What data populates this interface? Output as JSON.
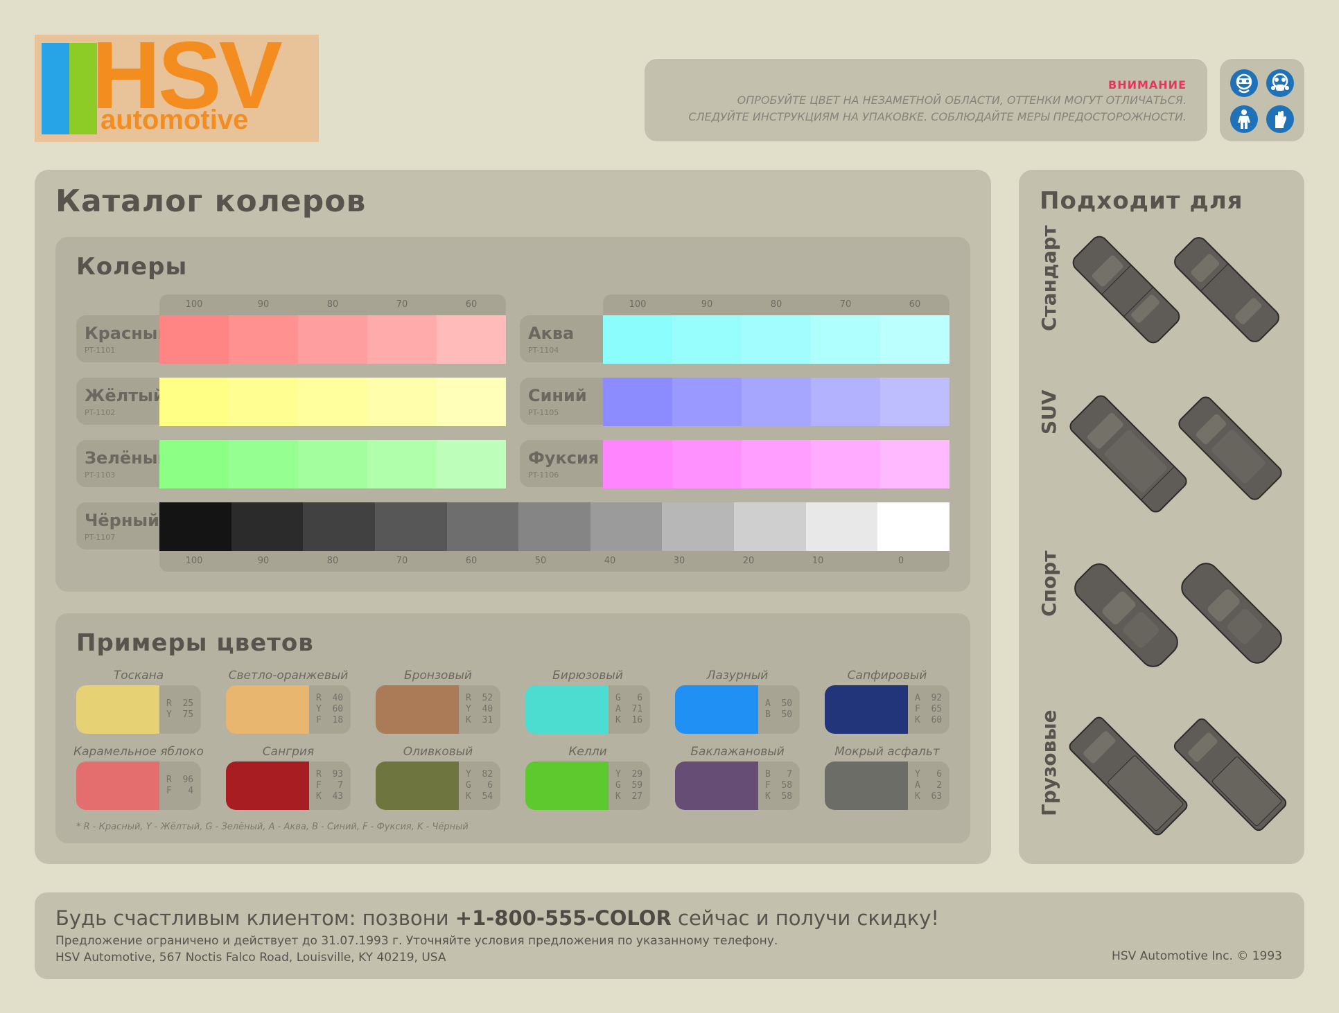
{
  "logo": {
    "hsv": "HSV",
    "automotive": "automotive"
  },
  "warning": {
    "title": "ВНИМАНИЕ",
    "line1": "ОПРОБУЙТЕ ЦВЕТ НА НЕЗАМЕТНОЙ ОБЛАСТИ, ОТТЕНКИ МОГУТ ОТЛИЧАТЬСЯ.",
    "line2": "СЛЕДУЙТЕ ИНСТРУКЦИЯМ НА УПАКОВКЕ. СОБЛЮДАЙТЕ МЕРЫ ПРЕДОСТОРОЖНОСТИ.",
    "icons": [
      "goggles-icon",
      "respirator-icon",
      "protective-suit-icon",
      "gloves-icon"
    ]
  },
  "catalog": {
    "title": "Каталог колеров",
    "tints_title": "Колеры",
    "scale_top": [
      "100",
      "90",
      "80",
      "70",
      "60"
    ],
    "scale_bottom": [
      "100",
      "90",
      "80",
      "70",
      "60",
      "50",
      "40",
      "30",
      "20",
      "10",
      "0"
    ],
    "tints": [
      {
        "name": "Красный",
        "code": "PT-1101",
        "colors": [
          "#ff8585",
          "#ff9191",
          "#ff9e9e",
          "#ffabab",
          "#ffbaba"
        ]
      },
      {
        "name": "Жёлтый",
        "code": "PT-1102",
        "colors": [
          "#ffff85",
          "#ffff91",
          "#ffff9e",
          "#ffffab",
          "#ffffba"
        ]
      },
      {
        "name": "Зелёный",
        "code": "PT-1103",
        "colors": [
          "#8cff85",
          "#96ff91",
          "#a3ff9e",
          "#b0ffab",
          "#bdffba"
        ]
      },
      {
        "name": "Аква",
        "code": "PT-1104",
        "colors": [
          "#8cfdfd",
          "#97fdfd",
          "#a2fefe",
          "#b0ffff",
          "#bcffff"
        ]
      },
      {
        "name": "Синий",
        "code": "PT-1105",
        "colors": [
          "#8c8cff",
          "#9999ff",
          "#a6a6ff",
          "#b2b2ff",
          "#bebeff"
        ]
      },
      {
        "name": "Фуксия",
        "code": "PT-1106",
        "colors": [
          "#ff85ff",
          "#ff91ff",
          "#ff9eff",
          "#ffabff",
          "#ffbaff"
        ]
      },
      {
        "name": "Чёрный",
        "code": "PT-1107",
        "colors": [
          "#141414",
          "#2b2b2b",
          "#414141",
          "#575757",
          "#6e6e6e",
          "#858585",
          "#9b9b9b",
          "#b7b7b7",
          "#cfcfcf",
          "#e8e8e8",
          "#ffffff"
        ]
      }
    ],
    "examples_title": "Примеры цветов",
    "examples": [
      {
        "name": "Тоскана",
        "color": "#e6d274",
        "mix": [
          "R  25",
          "Y  75"
        ]
      },
      {
        "name": "Светло-оранжевый",
        "color": "#e9b670",
        "mix": [
          "R  40",
          "Y  60",
          "F  18"
        ]
      },
      {
        "name": "Бронзовый",
        "color": "#ab7a56",
        "mix": [
          "R  52",
          "Y  40",
          "K  31"
        ]
      },
      {
        "name": "Бирюзовый",
        "color": "#4cdcd0",
        "mix": [
          "G   6",
          "A  71",
          "K  16"
        ]
      },
      {
        "name": "Лазурный",
        "color": "#2090f5",
        "mix": [
          "A  50",
          "B  50"
        ]
      },
      {
        "name": "Сапфировый",
        "color": "#22357a",
        "mix": [
          "A  92",
          "F  65",
          "K  60"
        ]
      },
      {
        "name": "Карамельное яблоко",
        "color": "#e46d6d",
        "mix": [
          "R  96",
          "F   4"
        ]
      },
      {
        "name": "Сангрия",
        "color": "#a71d22",
        "mix": [
          "R  93",
          "F   7",
          "K  43"
        ]
      },
      {
        "name": "Оливковый",
        "color": "#6e753f",
        "mix": [
          "Y  82",
          "G   6",
          "K  54"
        ]
      },
      {
        "name": "Келли",
        "color": "#5ec92e",
        "mix": [
          "Y  29",
          "G  59",
          "K  27"
        ]
      },
      {
        "name": "Баклажановый",
        "color": "#664d76",
        "mix": [
          "B   7",
          "F  58",
          "K  58"
        ]
      },
      {
        "name": "Мокрый асфальт",
        "color": "#6c6d66",
        "mix": [
          "Y   6",
          "A   2",
          "K  63"
        ]
      }
    ],
    "legend": "* R - Красный, Y - Жёлтый, G - Зелёный, A - Аква, B - Синий, F - Фуксия, K - Чёрный"
  },
  "fits": {
    "title": "Подходит для",
    "types": [
      "Стандарт",
      "SUV",
      "Спорт",
      "Грузовые"
    ]
  },
  "footer": {
    "promo_a": "Будь счастливым клиентом: позвони ",
    "phone": "+1-800-555-COLOR",
    "promo_b": " сейчас и получи скидку!",
    "offer": "Предложение ограничено и действует до 31.07.1993 г. Уточняйте условия предложения по указанному телефону.",
    "address": "HSV Automotive, 567 Noctis Falco Road, Louisville, KY 40219, USA",
    "copyright": "HSV Automotive Inc. © 1993"
  }
}
